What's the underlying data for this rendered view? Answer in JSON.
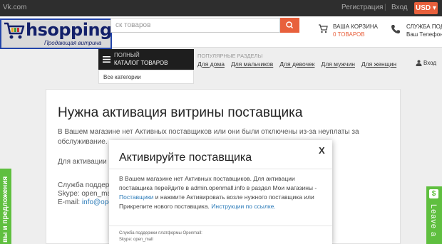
{
  "topbar": {
    "site_link": "Vk.com",
    "register": "Регистрация",
    "separator": "|",
    "login": "Вход",
    "currency": "USD ▾"
  },
  "logo": {
    "word": "hsopping",
    "tagline": "Продающая витрина"
  },
  "search": {
    "placeholder": "ск товаров"
  },
  "cart": {
    "label": "ВАША КОРЗИНА",
    "count": "0 ТОВАРОВ"
  },
  "support": {
    "label": "СЛУЖБА ПОД",
    "phone": "Ваш Телефон"
  },
  "catalog": {
    "line1": "ПОЛНЫЙ",
    "line2": "КАТАЛОГ ТОВАРОВ",
    "all_categories": "Все категории"
  },
  "nav": {
    "popular_label": "ПОПУЛЯРНЫЕ РАЗДЕЛЫ",
    "links": [
      "Для дома",
      "Для мальчиков",
      "Для девочек",
      "Для мужчин",
      "Для женщин"
    ],
    "login_right": "Вход"
  },
  "content": {
    "title": "Нужна активация витрины поставщика",
    "p1": "В Вашем магазине нет Активных поставщиков или они были отключены из-за неуплаты за обслуживание.",
    "p2": "Для активации по                                                                         Поставщики и нажмите Активи                                                                        а и сервиса",
    "p3_line1": "Служба поддерж",
    "p3_line2": "Skype: open_mal",
    "p3_line3_prefix": "E-mail: ",
    "p3_email": "info@ope"
  },
  "modal": {
    "close": "X",
    "title": "Активируйте поставщика",
    "body_text": "В Вашем магазине нет Активных поставщиков. Для активации поставщика перейдите в admin.openmall.info в раздел Мои магазины - ",
    "body_link1": "Поставщики",
    "body_text2": " и нажмите Активировать возле нужного поставщика или Прикрепите нового поставщика. ",
    "body_link2": "Инструкции по ссылке.",
    "footer_line1": "Служба поддержки платформы Openmall:",
    "footer_line2": "Skype: open_mall"
  },
  "feedback_tab": {
    "label": "вы и предложения"
  },
  "leave_tab": {
    "icon": "$",
    "label": "Leave a"
  },
  "colors": {
    "accent": "#e8603c",
    "green": "#5fbf3f",
    "dark": "#2e2e2e",
    "link": "#2a7ab8"
  }
}
